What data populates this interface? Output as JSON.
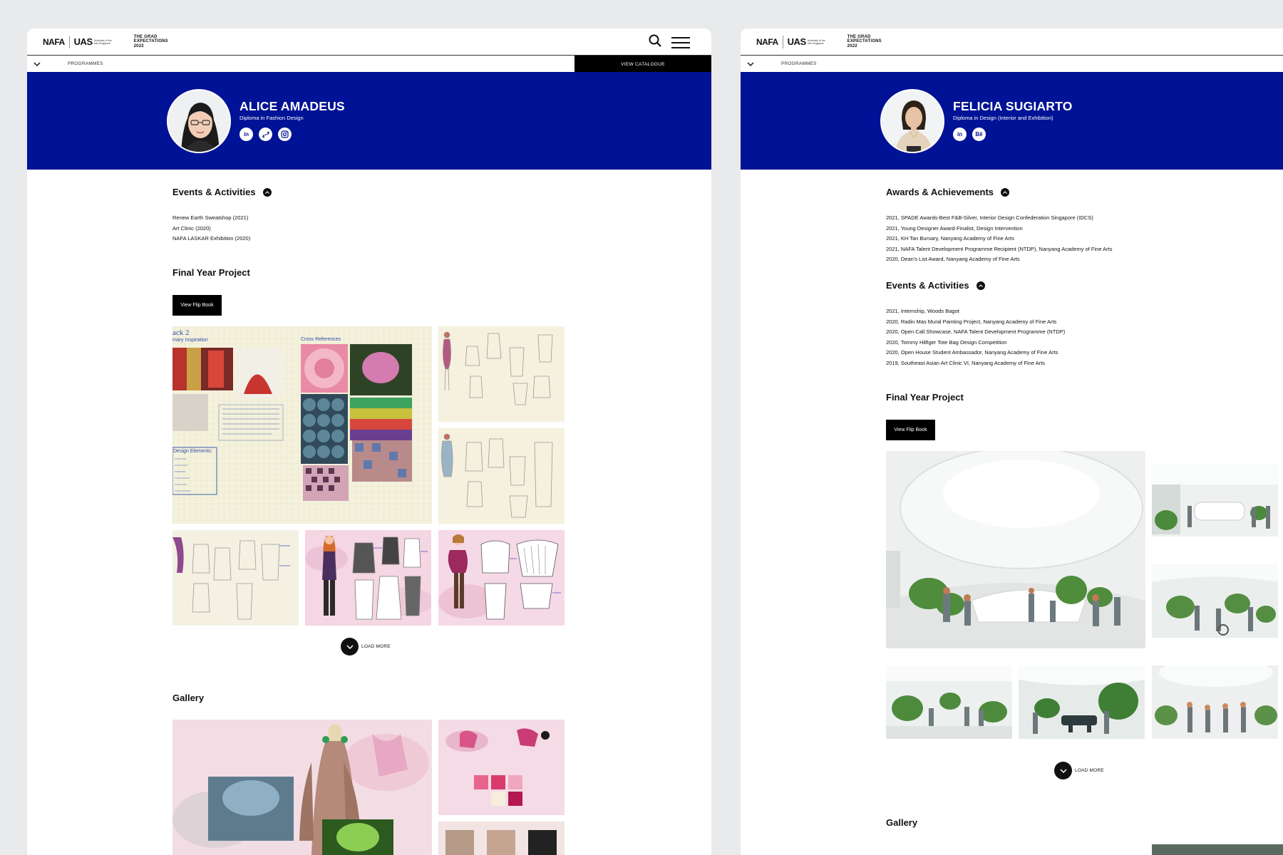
{
  "header": {
    "logo_nafa": "NAFA",
    "logo_uas": "UAS",
    "logo_uas_sub": "University of the Arts Singapore",
    "grad_title_line1": "THE GRAD",
    "grad_title_line2": "EXPECTATIONS",
    "grad_title_line3": "2022"
  },
  "subnav": {
    "programmes": "PROGRAMMES",
    "catalogue": "VIEW CATALOGUE"
  },
  "left": {
    "name": "ALICE AMADEUS",
    "programme": "Diploma in Fashion Design",
    "socials": [
      "linkedin-icon",
      "link-icon",
      "instagram-icon"
    ],
    "events_title": "Events & Activities",
    "events": [
      "Renew Earth Sweatshop (2021)",
      "Art Clinic (2020)",
      "NAFA LASKAR Exhibition (2020)"
    ],
    "fyp_title": "Final Year Project",
    "flip_book": "View Flip Book",
    "moodboard_title": "ack 2",
    "moodboard_sub": "mary Inspiration",
    "moodboard_ref": "Cross References",
    "moodboard_elements": "Design Elements:",
    "load_more": "LOAD MORE",
    "gallery_title": "Gallery"
  },
  "right": {
    "name": "FELICIA SUGIARTO",
    "programme": "Diploma in Design (Interior and Exhibition)",
    "socials": [
      "linkedin-icon",
      "behance-icon"
    ],
    "behance_label": "Bē",
    "awards_title": "Awards & Achievements",
    "awards": [
      "2021, SPADE Awards-Best F&B-Silver, Interior Design Confederation Singapore (IDCS)",
      "2021, Young Designer Award-Finalist, Design Intervention",
      "2021, KH Tan Bursary, Nanyang Academy of Fine Arts",
      "2021, NAFA Talent Development Programme Recipient (NTDP), Nanyang Academy of Fine Arts",
      "2020, Dean's List Award, Nanyang Academy of Fine Arts"
    ],
    "events_title": "Events & Activities",
    "events": [
      "2021, Internship, Woods Bagot",
      "2020, Radin Mas Mural Painting Project, Nanyang Academy of Fine Arts",
      "2020, Open Call Showcase, NAFA Talent Development Programme (NTDP)",
      "2020, Tommy Hilfiger Tote Bag Design Competition",
      "2020, Open House Student Ambassador, Nanyang Academy of Fine Arts",
      "2019, Southeast Asian Art Clinic VI, Nanyang Academy of Fine Arts"
    ],
    "fyp_title": "Final Year Project",
    "flip_book": "View Flip Book",
    "load_more": "LOAD MORE",
    "gallery_title": "Gallery"
  },
  "colors": {
    "hero_blue": "#001295",
    "page_bg": "#e9eaec",
    "black": "#000000"
  }
}
